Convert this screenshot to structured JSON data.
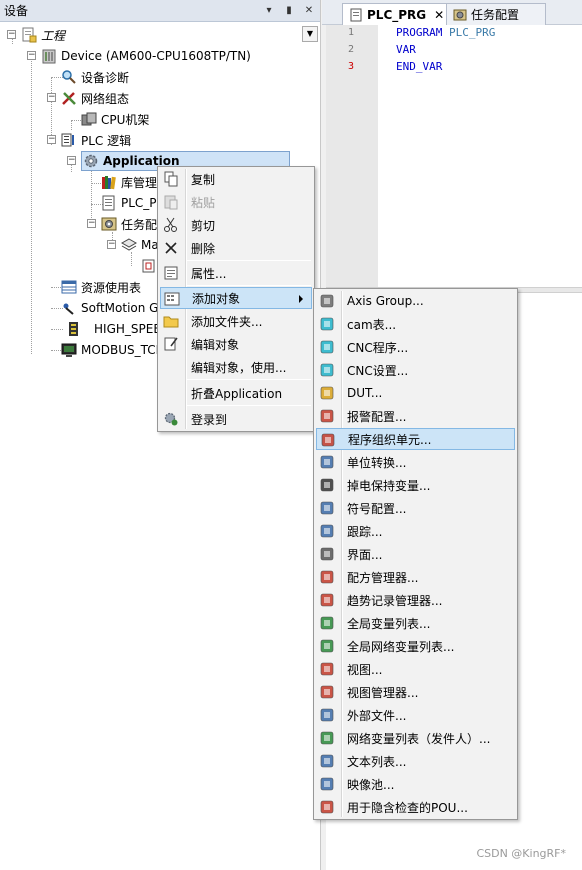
{
  "left_panel": {
    "title": "设备",
    "pin_btn": "▾",
    "pin2_btn": "ᵖ",
    "close_btn": "✕",
    "tree": {
      "project": "工程",
      "device": "Device (AM600-CPU1608TP/TN)",
      "diag": "设备诊断",
      "network": "网络组态",
      "cpu_rack": "CPU机架",
      "plc_logic": "PLC 逻辑",
      "application": "Application",
      "library": "库管理",
      "plc_prg": "PLC_PR",
      "task_config": "任务配",
      "main_task": "Ma",
      "resources": "资源使用表",
      "softmotion": "SoftMotion Gen",
      "high_speed": "HIGH_SPEED",
      "modbus": "MODBUS_TCP ("
    }
  },
  "editor": {
    "tabs": [
      {
        "label": "PLC_PRG",
        "close": "✕"
      },
      {
        "label": "任务配置"
      }
    ],
    "lines": [
      {
        "no": "1",
        "text": "PROGRAM",
        "extra": "PLC_PRG"
      },
      {
        "no": "2",
        "text": "VAR"
      },
      {
        "no": "3",
        "text": "END_VAR"
      }
    ]
  },
  "context_menu": {
    "items": [
      {
        "label": "复制",
        "icon": "copy-icon",
        "enabled": true
      },
      {
        "label": "粘贴",
        "icon": "paste-icon",
        "enabled": false
      },
      {
        "label": "剪切",
        "icon": "cut-icon",
        "enabled": true
      },
      {
        "label": "删除",
        "icon": "delete-icon",
        "enabled": true
      },
      {
        "label": "属性...",
        "icon": "properties-icon",
        "enabled": true
      },
      {
        "label": "添加对象",
        "icon": "add-object-icon",
        "enabled": true,
        "submenu": true
      },
      {
        "label": "添加文件夹...",
        "icon": "folder-icon",
        "enabled": true
      },
      {
        "label": "编辑对象",
        "icon": "edit-icon",
        "enabled": true
      },
      {
        "label": "编辑对象，使用...",
        "icon": "",
        "enabled": true
      },
      {
        "label": "折叠Application",
        "icon": "",
        "enabled": true
      },
      {
        "label": "登录到",
        "icon": "login-icon",
        "enabled": true
      }
    ]
  },
  "submenu": {
    "items": [
      {
        "label": "Axis Group...",
        "icon": "axis-group-icon"
      },
      {
        "label": "cam表...",
        "icon": "cam-table-icon"
      },
      {
        "label": "CNC程序...",
        "icon": "cnc-program-icon"
      },
      {
        "label": "CNC设置...",
        "icon": "cnc-settings-icon"
      },
      {
        "label": "DUT...",
        "icon": "dut-icon"
      },
      {
        "label": "报警配置...",
        "icon": "alarm-config-icon"
      },
      {
        "label": "程序组织单元...",
        "icon": "pou-icon"
      },
      {
        "label": "单位转换...",
        "icon": "unit-conversion-icon"
      },
      {
        "label": "掉电保持变量...",
        "icon": "persistent-vars-icon"
      },
      {
        "label": "符号配置...",
        "icon": "symbol-config-icon"
      },
      {
        "label": "跟踪...",
        "icon": "trace-icon"
      },
      {
        "label": "界面...",
        "icon": "interface-icon"
      },
      {
        "label": "配方管理器...",
        "icon": "recipe-manager-icon"
      },
      {
        "label": "趋势记录管理器...",
        "icon": "trend-manager-icon"
      },
      {
        "label": "全局变量列表...",
        "icon": "gvl-icon"
      },
      {
        "label": "全局网络变量列表...",
        "icon": "network-gvl-icon"
      },
      {
        "label": "视图...",
        "icon": "visu-icon"
      },
      {
        "label": "视图管理器...",
        "icon": "visu-manager-icon"
      },
      {
        "label": "外部文件...",
        "icon": "external-file-icon"
      },
      {
        "label": "网络变量列表（发件人）...",
        "icon": "network-var-sender-icon"
      },
      {
        "label": "文本列表...",
        "icon": "text-list-icon"
      },
      {
        "label": "映像池...",
        "icon": "image-pool-icon"
      },
      {
        "label": "用于隐含检查的POU...",
        "icon": "implicit-check-pou-icon"
      }
    ]
  },
  "watermark": "CSDN @KingRF*"
}
